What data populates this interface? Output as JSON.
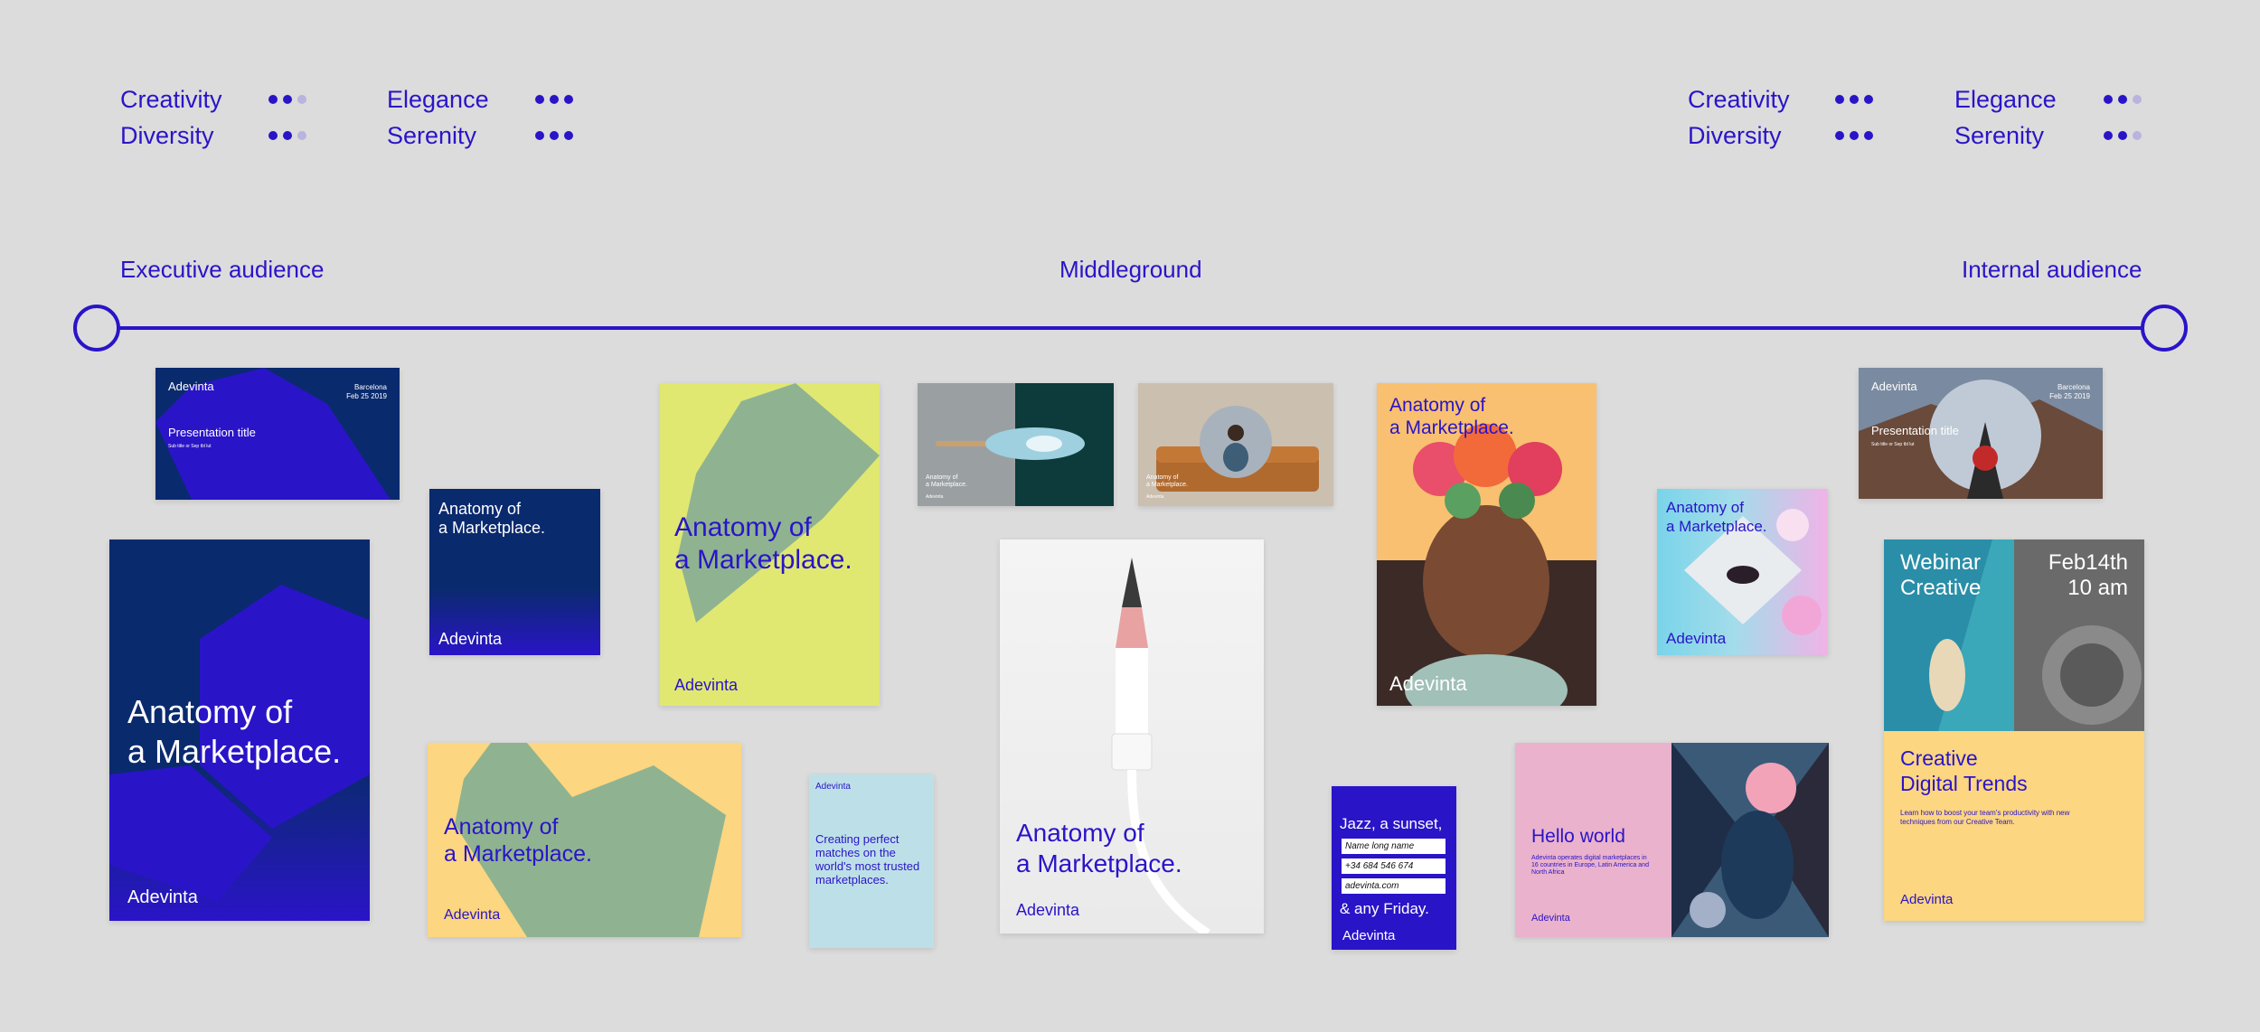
{
  "colors": {
    "accent": "#2a14c8",
    "background": "#dcdcdc",
    "navy": "#0a2a6e",
    "yellow": "#e0e872",
    "sage": "#8fb391",
    "peach": "#fcd680",
    "pink": "#eab2cc",
    "light_blue": "#bde0e8"
  },
  "left_attributes": [
    {
      "label": "Creativity",
      "level": 2
    },
    {
      "label": "Diversity",
      "level": 2
    },
    {
      "label": "Elegance",
      "level": 3
    },
    {
      "label": "Serenity",
      "level": 3
    }
  ],
  "right_attributes": [
    {
      "label": "Creativity",
      "level": 3
    },
    {
      "label": "Diversity",
      "level": 3
    },
    {
      "label": "Elegance",
      "level": 2
    },
    {
      "label": "Serenity",
      "level": 2
    }
  ],
  "audience": {
    "left": "Executive audience",
    "middle": "Middleground",
    "right": "Internal audience"
  },
  "cards": {
    "brand": "Adevinta",
    "anatomy_line1": "Anatomy of",
    "anatomy_line2": "a Marketplace.",
    "presentation_title": "Presentation title",
    "subtitle_placeholder": "Sub title or Sep tbl lut",
    "city": "Barcelona",
    "date": "Feb 25 2019",
    "matches_text": "Creating perfect matches on the world's most trusted marketplaces.",
    "jazz_line1": "Jazz, a sunset,",
    "jazz_fields": [
      "Name long name",
      "+34 684 546 674",
      "adevinta.com"
    ],
    "jazz_line2": "& any Friday.",
    "hello": "Hello world",
    "hello_body": "Adevinta operates digital marketplaces in 16 countries in Europe, Latin America and North Africa",
    "webinar_line1": "Webinar",
    "webinar_line2": "Creative",
    "webinar_date": "Feb14th",
    "webinar_time": "10 am",
    "trends_line1": "Creative",
    "trends_line2": "Digital Trends",
    "trends_body": "Learn how to boost your team's productivity with new techniques from our Creative Team."
  }
}
